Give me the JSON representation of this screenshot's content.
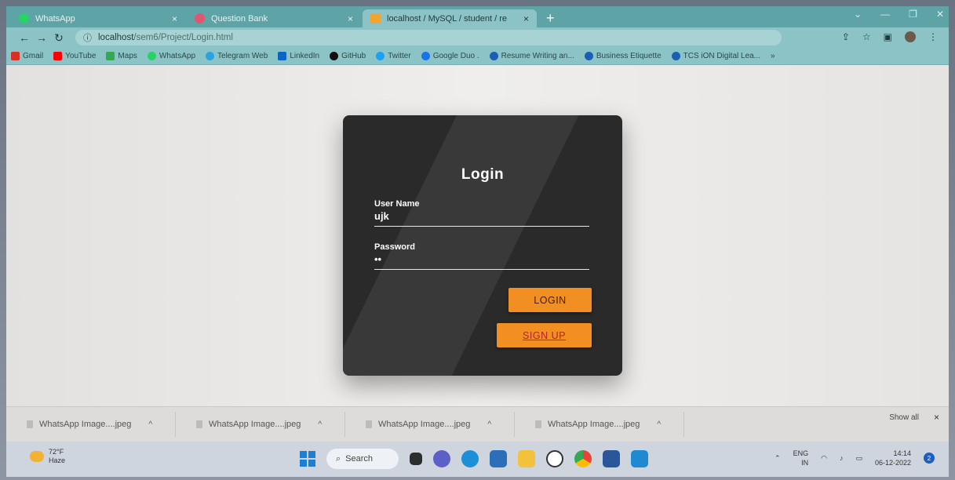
{
  "tabs": [
    {
      "title": "WhatsApp",
      "close": "×",
      "fav_color": "#25d366"
    },
    {
      "title": "Question Bank",
      "close": "×",
      "fav_color": "#e2556f"
    },
    {
      "title": "localhost / MySQL / student / re",
      "close": "×",
      "fav_color": "#f0a531"
    }
  ],
  "newtab": "+",
  "address": {
    "host": "localhost",
    "path": "/sem6/Project/Login.html"
  },
  "bookmarks": [
    {
      "label": "Gmail",
      "color": "#d93025"
    },
    {
      "label": "YouTube",
      "color": "#ff0000"
    },
    {
      "label": "Maps",
      "color": "#34a853"
    },
    {
      "label": "WhatsApp",
      "color": "#25d366"
    },
    {
      "label": "Telegram Web",
      "color": "#2aa3df"
    },
    {
      "label": "LinkedIn",
      "color": "#0a66c2"
    },
    {
      "label": "GitHub",
      "color": "#111111"
    },
    {
      "label": "Twitter",
      "color": "#1da1f2"
    },
    {
      "label": "Google Duo .",
      "color": "#1a73e8"
    },
    {
      "label": "Resume Writing an...",
      "color": "#1a5fb4"
    },
    {
      "label": "Business Etiquette",
      "color": "#1a5fb4"
    },
    {
      "label": "TCS iON Digital Lea...",
      "color": "#1a5fb4"
    }
  ],
  "login": {
    "title": "Login",
    "username_label": "User Name",
    "username_value": "ujk",
    "password_label": "Password",
    "password_value": "••",
    "login_button": "LOGIN",
    "signup_button": "SIGN UP"
  },
  "downloads": {
    "items": [
      "WhatsApp Image....jpeg",
      "WhatsApp Image....jpeg",
      "WhatsApp Image....jpeg",
      "WhatsApp Image....jpeg"
    ],
    "show_all": "Show all",
    "close": "×"
  },
  "taskbar": {
    "temp": "72°F",
    "weather": "Haze",
    "search": "Search",
    "lang": "ENG",
    "region": "IN",
    "time": "14:14",
    "date": "06-12-2022",
    "badge": "2"
  },
  "colors": {
    "accent_orange": "#f18f23",
    "card": "#2b2a2a",
    "chrome_teal": "#8cc3c6"
  }
}
